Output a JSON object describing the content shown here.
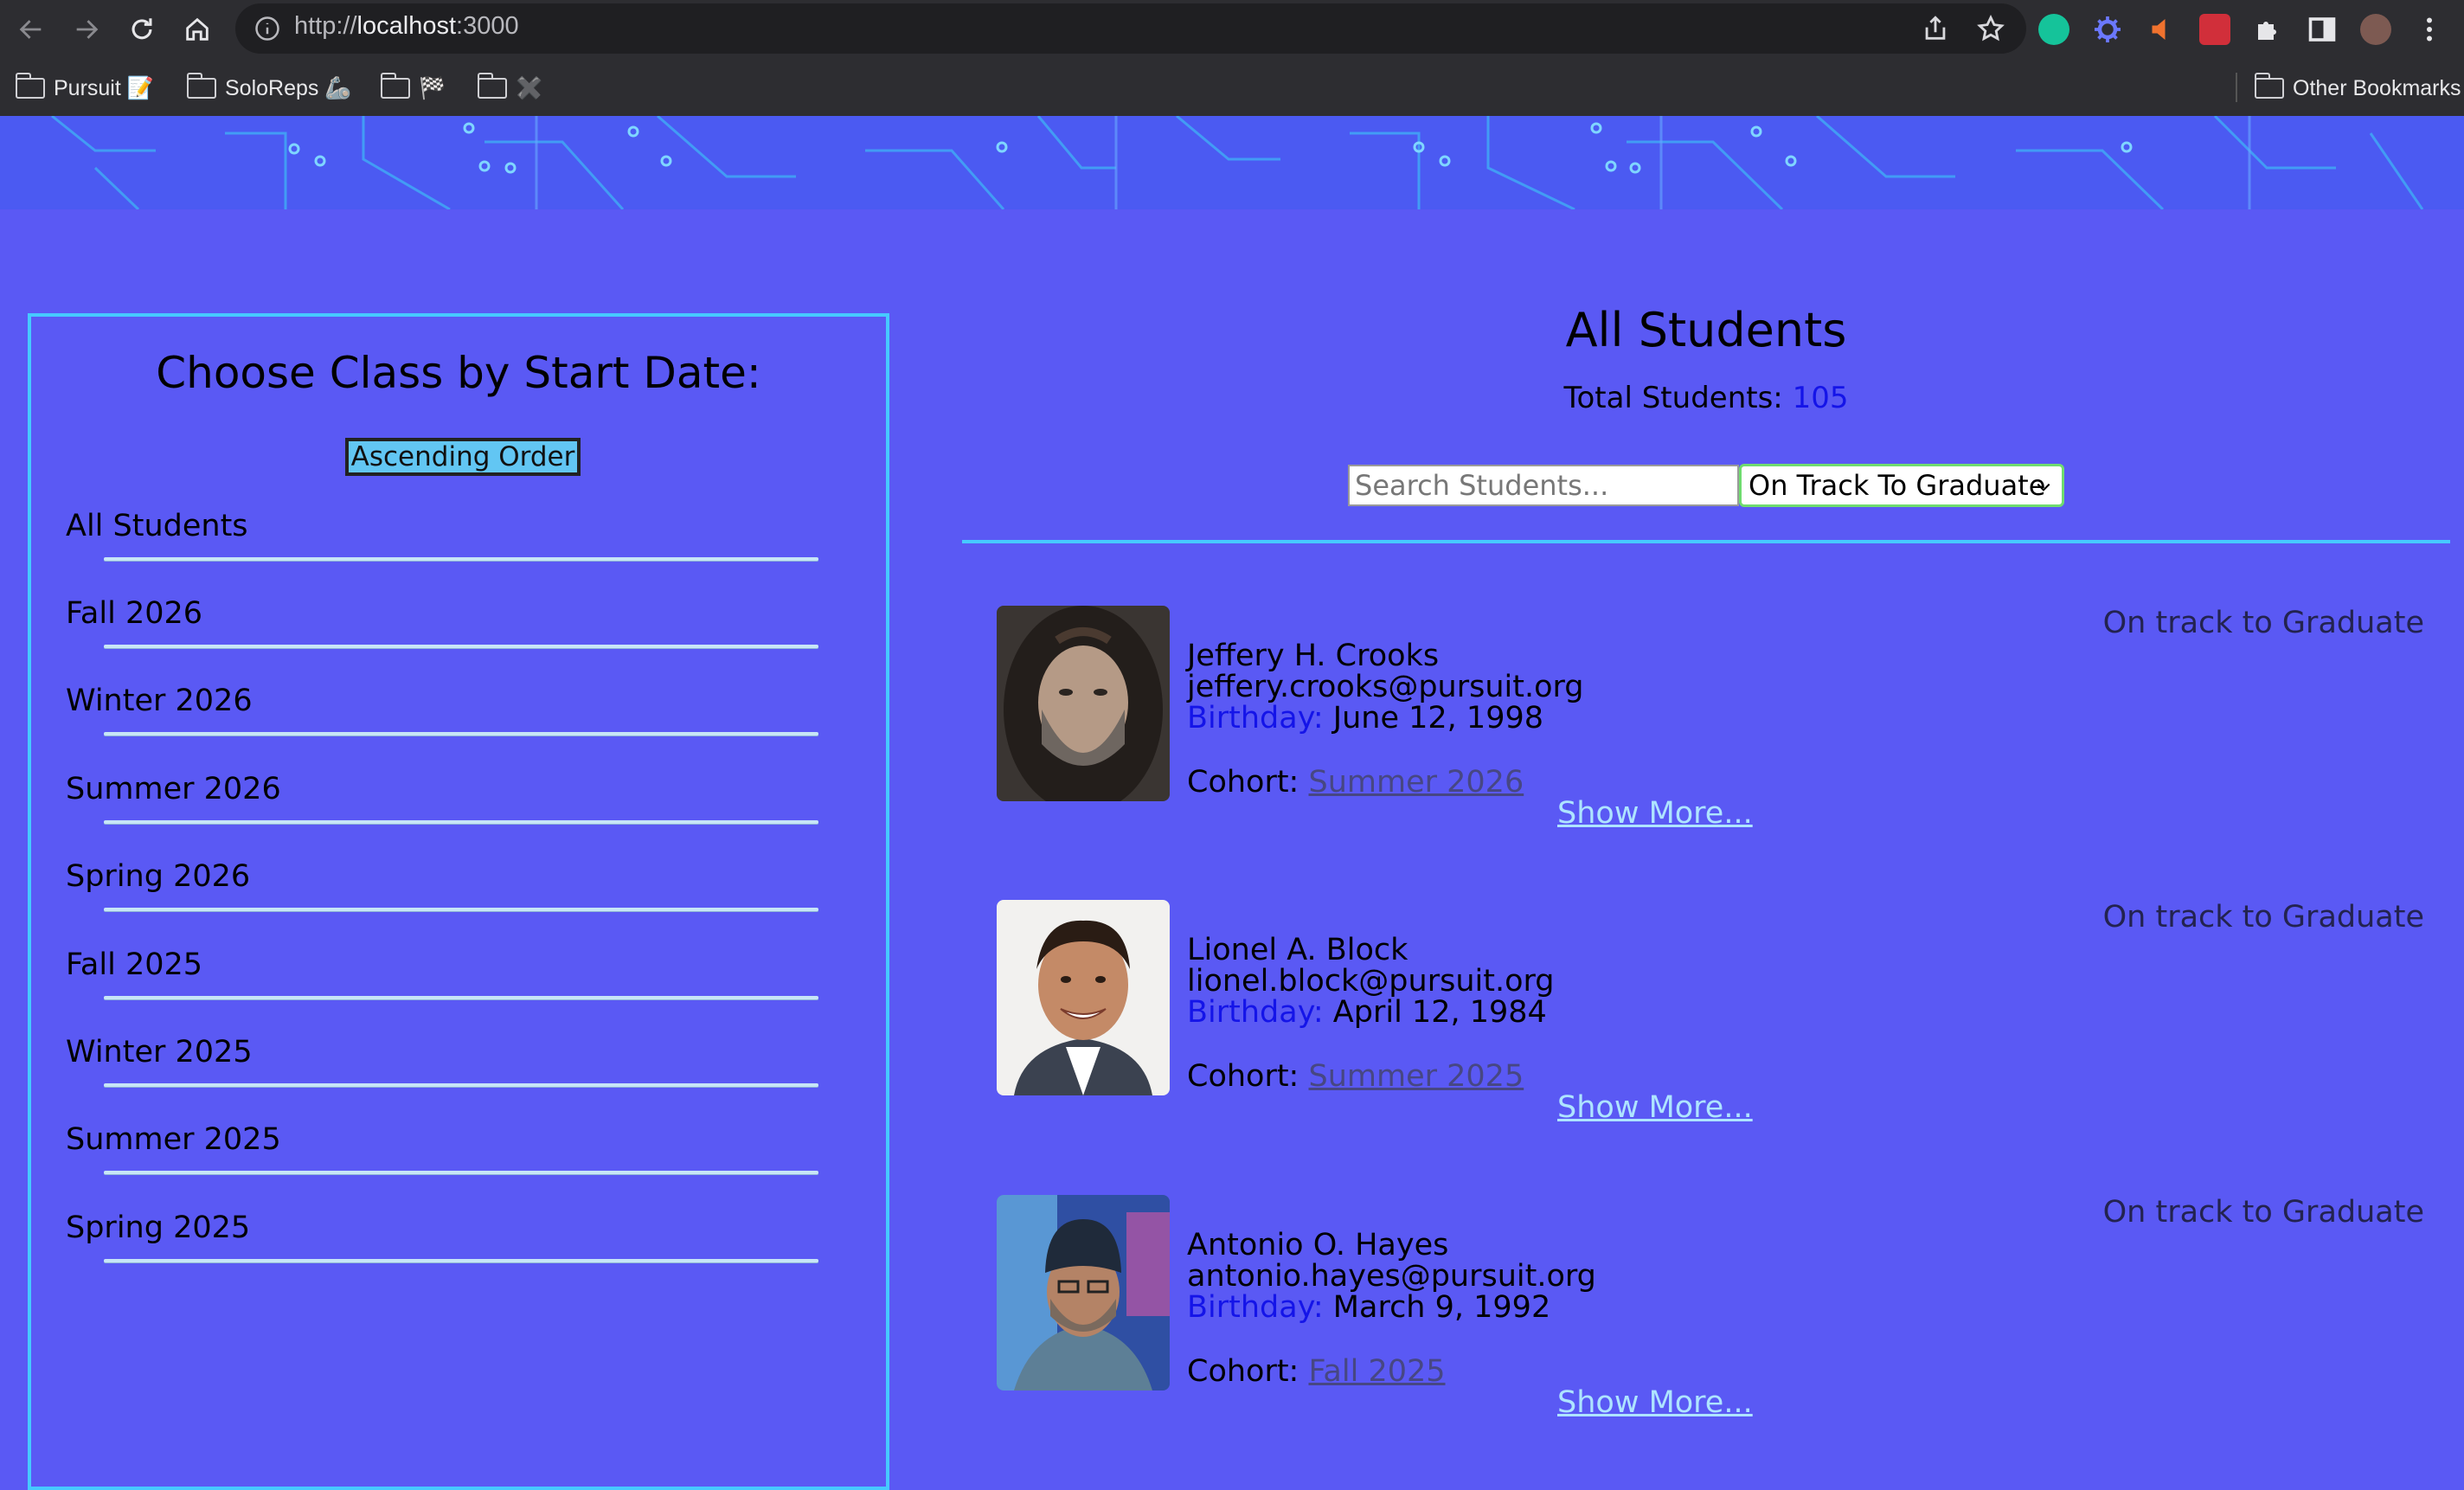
{
  "browser": {
    "url_prefix": "http://",
    "url_host": "localhost",
    "url_port": ":3000",
    "bookmarks": [
      {
        "label": "Pursuit 📝"
      },
      {
        "label": "SoloReps 🦾"
      },
      {
        "label": "🏁"
      },
      {
        "label": "✖️"
      }
    ],
    "other_bookmarks": "Other Bookmarks"
  },
  "sidebar": {
    "title": "Choose Class by Start Date:",
    "order_button": "Ascending Order",
    "items": [
      {
        "label": "All Students"
      },
      {
        "label": "Fall 2026"
      },
      {
        "label": "Winter 2026"
      },
      {
        "label": "Summer 2026"
      },
      {
        "label": "Spring 2026"
      },
      {
        "label": "Fall 2025"
      },
      {
        "label": "Winter 2025"
      },
      {
        "label": "Summer 2025"
      },
      {
        "label": "Spring 2025"
      }
    ]
  },
  "main": {
    "title": "All Students",
    "total_label": "Total Students:",
    "total_count": "105",
    "search_placeholder": "Search Students...",
    "filter_value": "On Track To Graduate",
    "students": [
      {
        "name": "Jeffery H. Crooks",
        "email": "jeffery.crooks@pursuit.org",
        "birthday_label": "Birthday:",
        "birthday": "June 12, 1998",
        "cohort_label": "Cohort:",
        "cohort": "Summer 2026",
        "show_more": "Show More...",
        "status": "On track to Graduate"
      },
      {
        "name": "Lionel A. Block",
        "email": "lionel.block@pursuit.org",
        "birthday_label": "Birthday:",
        "birthday": "April 12, 1984",
        "cohort_label": "Cohort:",
        "cohort": "Summer 2025",
        "show_more": "Show More...",
        "status": "On track to Graduate"
      },
      {
        "name": "Antonio O. Hayes",
        "email": "antonio.hayes@pursuit.org",
        "birthday_label": "Birthday:",
        "birthday": "March 9, 1992",
        "cohort_label": "Cohort:",
        "cohort": "Fall 2025",
        "show_more": "Show More...",
        "status": "On track to Graduate"
      }
    ]
  },
  "colors": {
    "page_bg": "#5a59f4",
    "panel_border": "#46c9ff",
    "accent_blue": "#1414e8",
    "link_light": "#aee4ff"
  }
}
